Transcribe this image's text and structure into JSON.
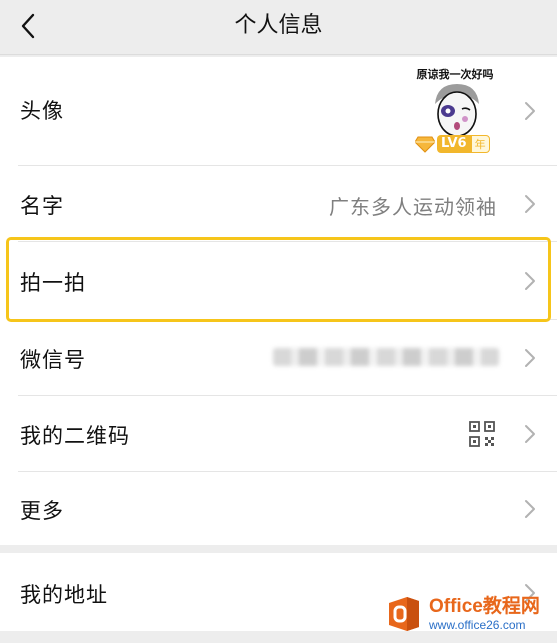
{
  "header": {
    "title": "个人信息"
  },
  "rows": {
    "avatar": {
      "label": "头像",
      "sticker_caption": "原谅我一次好吗",
      "level": "LV6",
      "level_sub": "年"
    },
    "name": {
      "label": "名字",
      "value": "广东多人运动领袖"
    },
    "pat": {
      "label": "拍一拍"
    },
    "wechat_id": {
      "label": "微信号"
    },
    "qr_code": {
      "label": "我的二维码"
    },
    "more": {
      "label": "更多"
    },
    "address": {
      "label": "我的地址"
    }
  },
  "watermark": {
    "title": "Office教程网",
    "url": "www.office26.com"
  },
  "colors": {
    "highlight": "#f6c51a",
    "background": "#ededed",
    "watermark_orange": "#e8671b",
    "watermark_blue": "#2a6fc7"
  }
}
